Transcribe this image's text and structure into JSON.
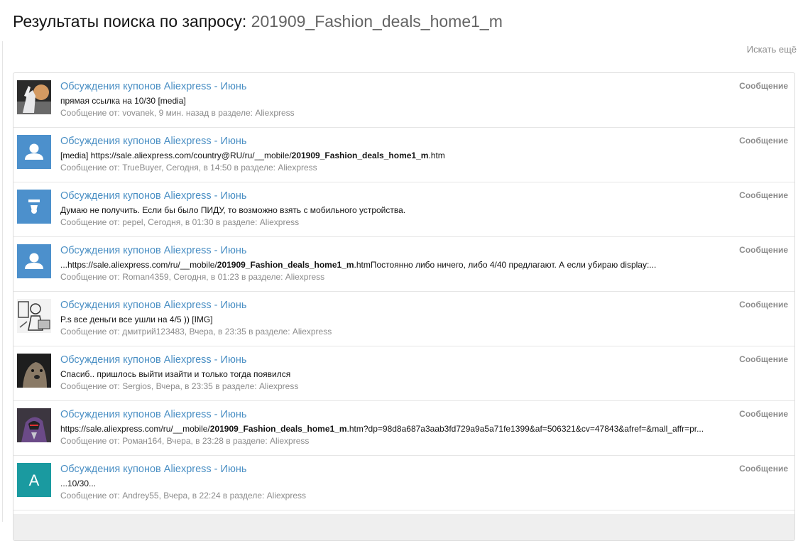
{
  "page": {
    "title_prefix": "Результаты поиска по запросу: ",
    "query": "201909_Fashion_deals_home1_m",
    "search_more": "Искать ещё"
  },
  "colors": {
    "link": "#4a8fc4",
    "muted": "#8c8c8c",
    "avatar_blue": "#4c90cc",
    "avatar_teal": "#1a9aa0"
  },
  "results": [
    {
      "title": "Обсуждения купонов Aliexpress - Июнь",
      "snippet_pre": "прямая ссылка на 10/30 [media]",
      "snippet_bold": "",
      "snippet_post": "",
      "meta_prefix": "Сообщение от: ",
      "author": "vovanek",
      "time": ", 9 мин. назад в разделе: ",
      "forum": "Aliexpress",
      "type": "Сообщение",
      "avatar": "photo-hand-icon"
    },
    {
      "title": "Обсуждения купонов Aliexpress - Июнь",
      "snippet_pre": "[media] https://sale.aliexpress.com/country@RU/ru/__mobile/",
      "snippet_bold": "201909_Fashion_deals_home1_m",
      "snippet_post": ".htm",
      "meta_prefix": "Сообщение от: ",
      "author": "TrueBuyer",
      "time": ", Сегодня, в 14:50 в разделе: ",
      "forum": "Aliexpress",
      "type": "Сообщение",
      "avatar": "default-user-icon"
    },
    {
      "title": "Обсуждения купонов Aliexpress - Июнь",
      "snippet_pre": "Думаю не получить. Если бы было ПИДУ, то возможно взять с мобильного устройства.",
      "snippet_bold": "",
      "snippet_post": "",
      "meta_prefix": "Сообщение от: ",
      "author": "pepel",
      "time": ", Сегодня, в 01:30 в разделе: ",
      "forum": "Aliexpress",
      "type": "Сообщение",
      "avatar": "default-user-partial-icon"
    },
    {
      "title": "Обсуждения купонов Aliexpress - Июнь",
      "snippet_pre": "...https://sale.aliexpress.com/ru/__mobile/",
      "snippet_bold": "201909_Fashion_deals_home1_m",
      "snippet_post": ".htmПостоянно либо ничего, либо 4/40 предлагают. А если убираю display:...",
      "meta_prefix": "Сообщение от: ",
      "author": "Roman4359",
      "time": ", Сегодня, в 01:23 в разделе: ",
      "forum": "Aliexpress",
      "type": "Сообщение",
      "avatar": "default-user-icon"
    },
    {
      "title": "Обсуждения купонов Aliexpress - Июнь",
      "snippet_pre": "P.s все деньги все ушли на 4/5 )) [IMG]",
      "snippet_bold": "",
      "snippet_post": "",
      "meta_prefix": "Сообщение от: ",
      "author": "дмитрий123483",
      "time": ", Вчера, в 23:35 в разделе: ",
      "forum": "Aliexpress",
      "type": "Сообщение",
      "avatar": "photo-sketch-icon"
    },
    {
      "title": "Обсуждения купонов Aliexpress - Июнь",
      "snippet_pre": "Спасиб.. пришлось выйти изайти и только тогда появился",
      "snippet_bold": "",
      "snippet_post": "",
      "meta_prefix": "Сообщение от: ",
      "author": "Sergios",
      "time": ", Вчера, в 23:35 в разделе: ",
      "forum": "Aliexpress",
      "type": "Сообщение",
      "avatar": "photo-dog-icon"
    },
    {
      "title": "Обсуждения купонов Aliexpress - Июнь",
      "snippet_pre": "https://sale.aliexpress.com/ru/__mobile/",
      "snippet_bold": "201909_Fashion_deals_home1_m",
      "snippet_post": ".htm?dp=98d8a687a3aab3fd729a9a5a71fe1399&af=506321&cv=47843&afref=&mall_affr=pr...",
      "meta_prefix": "Сообщение от: ",
      "author": "Роман164",
      "time": ", Вчера, в 23:28 в разделе: ",
      "forum": "Aliexpress",
      "type": "Сообщение",
      "avatar": "photo-hero-icon"
    },
    {
      "title": "Обсуждения купонов Aliexpress - Июнь",
      "snippet_pre": "...10/30...",
      "snippet_bold": "",
      "snippet_post": "",
      "meta_prefix": "Сообщение от: ",
      "author": "Andrey55",
      "time": ", Вчера, в 22:24 в разделе: ",
      "forum": "Aliexpress",
      "type": "Сообщение",
      "avatar": "letter-avatar-icon",
      "avatar_letter": "A"
    }
  ]
}
